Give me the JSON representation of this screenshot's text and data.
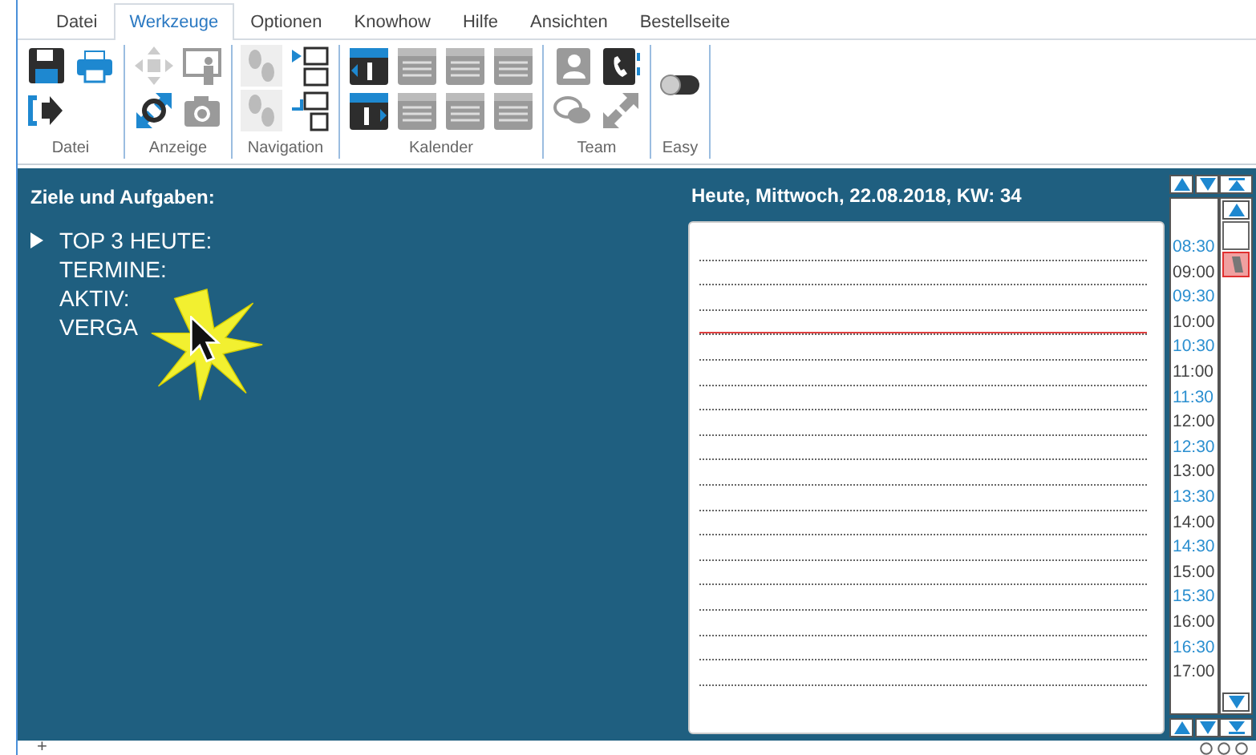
{
  "tabs": [
    {
      "label": "Datei",
      "selected": false
    },
    {
      "label": "Werkzeuge",
      "selected": true
    },
    {
      "label": "Optionen",
      "selected": false
    },
    {
      "label": "Knowhow",
      "selected": false
    },
    {
      "label": "Hilfe",
      "selected": false
    },
    {
      "label": "Ansichten",
      "selected": false
    },
    {
      "label": "Bestellseite",
      "selected": false
    }
  ],
  "ribbon_groups": [
    {
      "label": "Datei"
    },
    {
      "label": "Anzeige"
    },
    {
      "label": "Navigation"
    },
    {
      "label": "Kalender"
    },
    {
      "label": "Team"
    },
    {
      "label": "Easy",
      "toggle_on": false
    }
  ],
  "goals": {
    "title": "Ziele und Aufgaben:",
    "items": [
      {
        "label": "TOP 3 HEUTE:",
        "selected": true
      },
      {
        "label": "TERMINE:",
        "selected": false
      },
      {
        "label": "AKTIV:",
        "selected": false
      },
      {
        "label": "VERGA",
        "selected": false
      }
    ]
  },
  "day": {
    "title": "Heute, Mittwoch, 22.08.2018, KW: 34"
  },
  "times": [
    {
      "time": "08:30",
      "kind": "half",
      "now": false
    },
    {
      "time": "09:00",
      "kind": "full",
      "now": false
    },
    {
      "time": "09:30",
      "kind": "half",
      "now": false
    },
    {
      "time": "10:00",
      "kind": "full",
      "now": false
    },
    {
      "time": "10:30",
      "kind": "half",
      "now": true
    },
    {
      "time": "11:00",
      "kind": "full",
      "now": false
    },
    {
      "time": "11:30",
      "kind": "half",
      "now": false
    },
    {
      "time": "12:00",
      "kind": "full",
      "now": false
    },
    {
      "time": "12:30",
      "kind": "half",
      "now": false
    },
    {
      "time": "13:00",
      "kind": "full",
      "now": false
    },
    {
      "time": "13:30",
      "kind": "half",
      "now": false
    },
    {
      "time": "14:00",
      "kind": "full",
      "now": false
    },
    {
      "time": "14:30",
      "kind": "half",
      "now": false
    },
    {
      "time": "15:00",
      "kind": "full",
      "now": false
    },
    {
      "time": "15:30",
      "kind": "half",
      "now": false
    },
    {
      "time": "16:00",
      "kind": "full",
      "now": false
    },
    {
      "time": "16:30",
      "kind": "half",
      "now": false
    },
    {
      "time": "17:00",
      "kind": "full",
      "now": false
    }
  ],
  "status_bar": {
    "add": "+"
  }
}
